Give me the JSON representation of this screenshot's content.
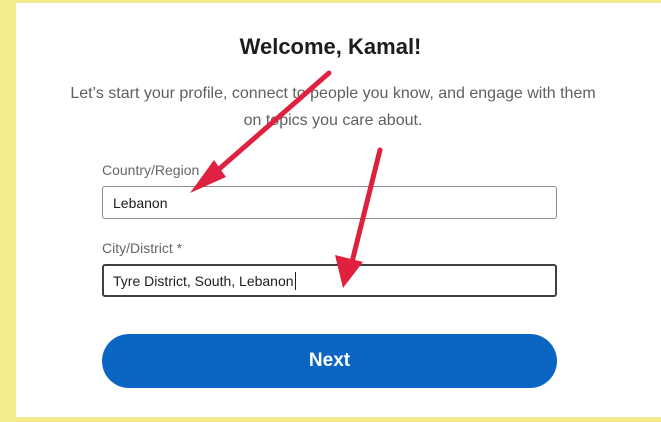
{
  "header": {
    "title": "Welcome, Kamal!"
  },
  "intro": {
    "line1": "Let’s start your profile, connect to people you know, and engage with them",
    "line2": "on topics you care about."
  },
  "form": {
    "country": {
      "label": "Country/Region",
      "value": "Lebanon"
    },
    "city": {
      "label": "City/District",
      "required_mark": "*",
      "value": "Tyre District, South, Lebanon"
    }
  },
  "actions": {
    "next_label": "Next"
  },
  "colors": {
    "accent": "#0a66c2",
    "annotation_arrow": "#e0203f",
    "highlight_border": "#f3ec8f"
  }
}
